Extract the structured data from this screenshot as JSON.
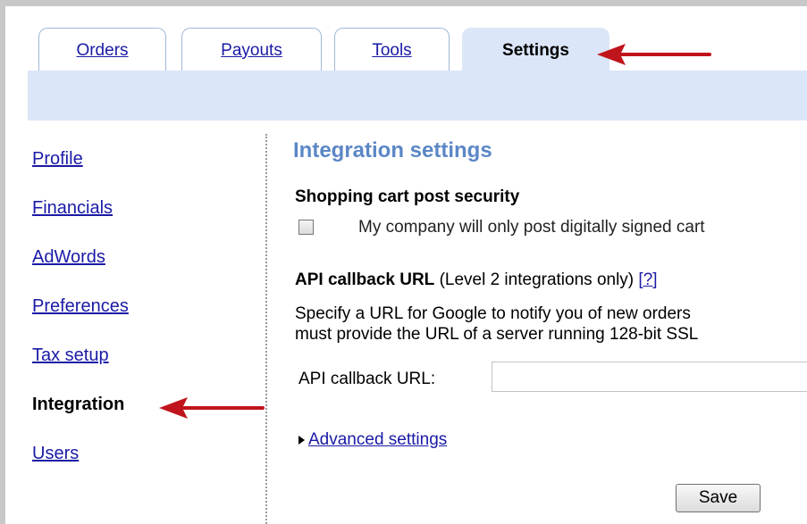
{
  "tabs": [
    {
      "label": "Orders"
    },
    {
      "label": "Payouts"
    },
    {
      "label": "Tools"
    },
    {
      "label": "Settings"
    }
  ],
  "sidebar": {
    "items": [
      {
        "label": "Profile"
      },
      {
        "label": "Financials"
      },
      {
        "label": "AdWords"
      },
      {
        "label": "Preferences"
      },
      {
        "label": "Tax setup"
      },
      {
        "label": "Integration"
      },
      {
        "label": "Users"
      }
    ],
    "current": "Integration"
  },
  "main": {
    "title": "Integration settings",
    "cart_security": {
      "heading": "Shopping cart post security",
      "checkbox_label": "My company will only post digitally signed cart",
      "checked": false
    },
    "api_callback": {
      "heading": "API callback URL",
      "note": "(Level 2 integrations only)",
      "help_link": "[?]",
      "description_line1": "Specify a URL for Google to notify you of new orders",
      "description_line2": "must provide the URL of a server running 128-bit SSL",
      "field_label": "API callback URL:",
      "field_value": ""
    },
    "advanced_link": "Advanced settings",
    "save_label": "Save"
  },
  "colors": {
    "tab_strip": "#dbe6f8",
    "title": "#5b87c6",
    "link": "#1a1aa6",
    "arrow": "#c0141c"
  }
}
